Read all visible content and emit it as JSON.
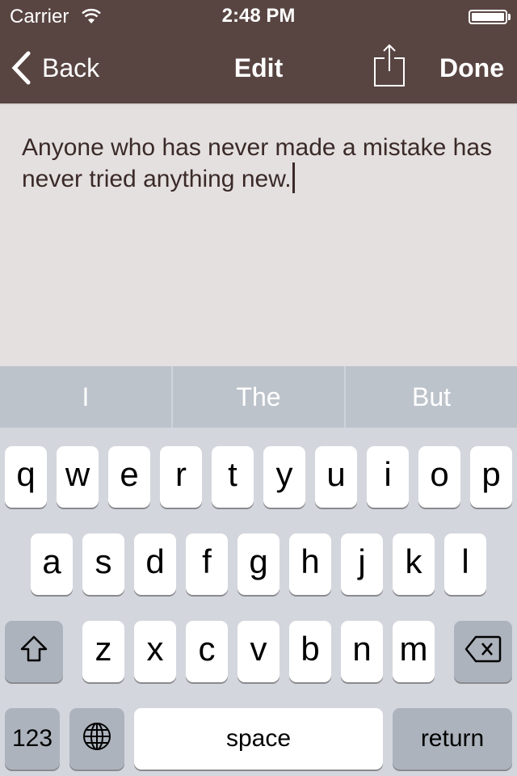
{
  "status_bar": {
    "carrier": "Carrier",
    "time": "2:48 PM",
    "battery_level": 1.0
  },
  "nav": {
    "back_label": "Back",
    "title": "Edit",
    "share_icon": "share-icon",
    "done_label": "Done"
  },
  "editor": {
    "text": "Anyone who has never made a mistake has never tried anything new."
  },
  "suggestions": [
    "I",
    "The",
    "But"
  ],
  "keyboard": {
    "row1": [
      "q",
      "w",
      "e",
      "r",
      "t",
      "y",
      "u",
      "i",
      "o",
      "p"
    ],
    "row2": [
      "a",
      "s",
      "d",
      "f",
      "g",
      "h",
      "j",
      "k",
      "l"
    ],
    "row3": [
      "z",
      "x",
      "c",
      "v",
      "b",
      "n",
      "m"
    ],
    "shift_icon": "shift-icon",
    "delete_icon": "backspace-icon",
    "numbers_label": "123",
    "globe_icon": "globe-icon",
    "space_label": "space",
    "return_label": "return"
  },
  "colors": {
    "nav_bg": "#584542",
    "editor_bg": "#e4e0df",
    "text": "#3a2a28"
  }
}
